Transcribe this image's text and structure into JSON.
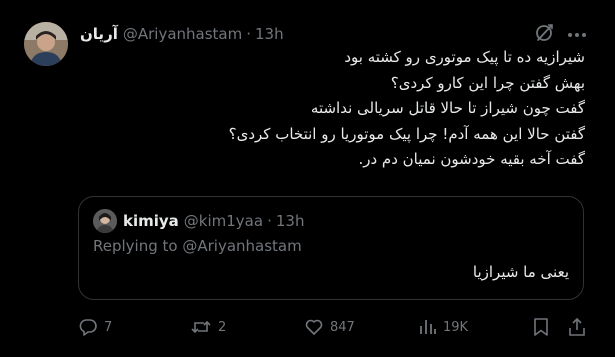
{
  "author": {
    "display_name": "آریان",
    "handle": "@Ariyanhastam",
    "separator": "·",
    "time": "13h"
  },
  "tweet": {
    "lines": [
      "شیرازیه ده تا پیک موتوری رو کشته بود",
      "بهش گفتن چرا این کارو کردی؟",
      "گفت چون شیراز تا حالا قاتل سریالی نداشته",
      "گفتن حالا این همه آدم! چرا پیک موتوریا رو انتخاب کردی؟",
      "گفت آخه بقیه خودشون نمیان دم در."
    ]
  },
  "quote": {
    "display_name": "kimiya",
    "handle": "@kim1yaa",
    "separator": "·",
    "time": "13h",
    "replying_prefix": "Replying to",
    "replying_handle": "@Ariyanhastam",
    "text": "یعنی ما شیرازیا"
  },
  "actions": {
    "reply_count": "7",
    "retweet_count": "2",
    "like_count": "847",
    "views_count": "19K"
  },
  "icons": {
    "grok": "grok-icon",
    "more": "more-icon",
    "reply": "reply-icon",
    "retweet": "retweet-icon",
    "like": "heart-icon",
    "views": "views-icon",
    "bookmark": "bookmark-icon",
    "share": "share-icon"
  },
  "colors": {
    "background": "#000000",
    "text_primary": "#e7e9ea",
    "text_secondary": "#71767b",
    "border": "#2f3336"
  }
}
